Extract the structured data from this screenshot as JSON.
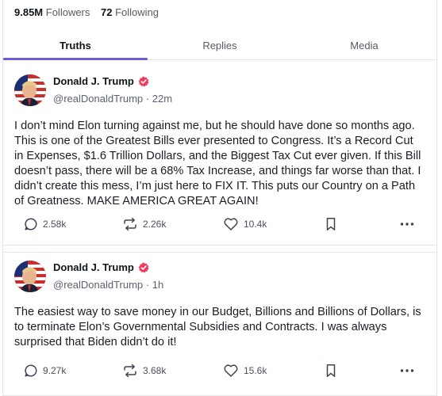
{
  "profile_stats": {
    "followers_count": "9.85M",
    "followers_label": "Followers",
    "following_count": "72",
    "following_label": "Following"
  },
  "tabs": [
    {
      "label": "Truths",
      "active": true
    },
    {
      "label": "Replies",
      "active": false
    },
    {
      "label": "Media",
      "active": false
    }
  ],
  "colors": {
    "accent": "#6d5ed8",
    "verified_badge": "#ef3b5d"
  },
  "posts": [
    {
      "author_name": "Donald J. Trump",
      "handle": "@realDonaldTrump",
      "separator": "·",
      "time": "22m",
      "text": "I don’t mind Elon turning against me, but he should have done so months ago. This is one of the Greatest Bills ever presented to Congress. It’s a Record Cut in Expenses, $1.6 Trillion Dollars, and the Biggest Tax Cut ever given. If this Bill doesn’t pass, there will be a 68% Tax Increase, and things far worse than that. I didn’t create this mess, I’m just here to FIX IT. This puts our Country on a Path of Greatness. MAKE AMERICA GREAT AGAIN!",
      "replies": "2.58k",
      "retruths": "2.26k",
      "likes": "10.4k"
    },
    {
      "author_name": "Donald J. Trump",
      "handle": "@realDonaldTrump",
      "separator": "·",
      "time": "1h",
      "text": "The easiest way to save money in our Budget, Billions and Billions of Dollars, is to terminate Elon’s Governmental Subsidies and Contracts. I was always surprised that Biden didn’t do it!",
      "replies": "9.27k",
      "retruths": "3.68k",
      "likes": "15.6k"
    }
  ],
  "icons": [
    "reply-icon",
    "retruth-icon",
    "like-icon",
    "bookmark-icon",
    "more-icon",
    "verified-icon"
  ]
}
